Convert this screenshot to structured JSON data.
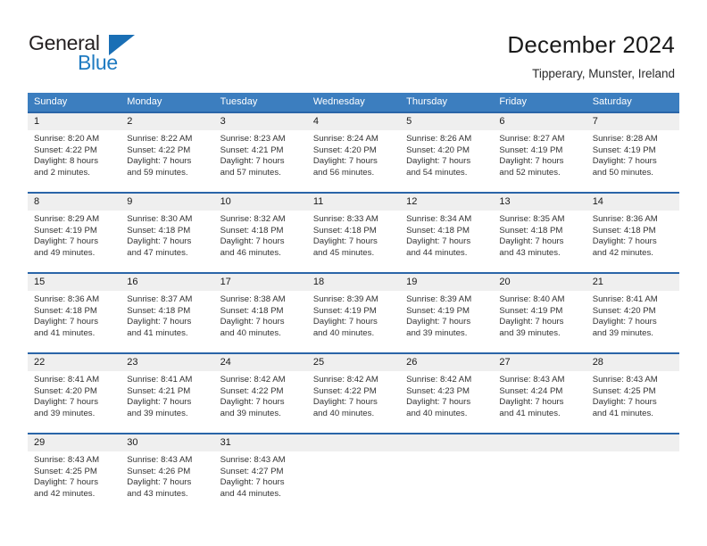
{
  "brand": {
    "name_part1": "General",
    "name_part2": "Blue",
    "flag_icon": "triangle-flag-icon",
    "accent_color": "#1a6fb5"
  },
  "header": {
    "title": "December 2024",
    "subtitle": "Tipperary, Munster, Ireland"
  },
  "colors": {
    "header_blue": "#3c7ebf",
    "separator_blue": "#2a65a8",
    "daynum_strip": "#efefef",
    "text": "#333333"
  },
  "calendar": {
    "day_headers": [
      "Sunday",
      "Monday",
      "Tuesday",
      "Wednesday",
      "Thursday",
      "Friday",
      "Saturday"
    ],
    "weeks": [
      [
        {
          "day": "1",
          "sunrise": "Sunrise: 8:20 AM",
          "sunset": "Sunset: 4:22 PM",
          "daylight1": "Daylight: 8 hours",
          "daylight2": "and 2 minutes."
        },
        {
          "day": "2",
          "sunrise": "Sunrise: 8:22 AM",
          "sunset": "Sunset: 4:22 PM",
          "daylight1": "Daylight: 7 hours",
          "daylight2": "and 59 minutes."
        },
        {
          "day": "3",
          "sunrise": "Sunrise: 8:23 AM",
          "sunset": "Sunset: 4:21 PM",
          "daylight1": "Daylight: 7 hours",
          "daylight2": "and 57 minutes."
        },
        {
          "day": "4",
          "sunrise": "Sunrise: 8:24 AM",
          "sunset": "Sunset: 4:20 PM",
          "daylight1": "Daylight: 7 hours",
          "daylight2": "and 56 minutes."
        },
        {
          "day": "5",
          "sunrise": "Sunrise: 8:26 AM",
          "sunset": "Sunset: 4:20 PM",
          "daylight1": "Daylight: 7 hours",
          "daylight2": "and 54 minutes."
        },
        {
          "day": "6",
          "sunrise": "Sunrise: 8:27 AM",
          "sunset": "Sunset: 4:19 PM",
          "daylight1": "Daylight: 7 hours",
          "daylight2": "and 52 minutes."
        },
        {
          "day": "7",
          "sunrise": "Sunrise: 8:28 AM",
          "sunset": "Sunset: 4:19 PM",
          "daylight1": "Daylight: 7 hours",
          "daylight2": "and 50 minutes."
        }
      ],
      [
        {
          "day": "8",
          "sunrise": "Sunrise: 8:29 AM",
          "sunset": "Sunset: 4:19 PM",
          "daylight1": "Daylight: 7 hours",
          "daylight2": "and 49 minutes."
        },
        {
          "day": "9",
          "sunrise": "Sunrise: 8:30 AM",
          "sunset": "Sunset: 4:18 PM",
          "daylight1": "Daylight: 7 hours",
          "daylight2": "and 47 minutes."
        },
        {
          "day": "10",
          "sunrise": "Sunrise: 8:32 AM",
          "sunset": "Sunset: 4:18 PM",
          "daylight1": "Daylight: 7 hours",
          "daylight2": "and 46 minutes."
        },
        {
          "day": "11",
          "sunrise": "Sunrise: 8:33 AM",
          "sunset": "Sunset: 4:18 PM",
          "daylight1": "Daylight: 7 hours",
          "daylight2": "and 45 minutes."
        },
        {
          "day": "12",
          "sunrise": "Sunrise: 8:34 AM",
          "sunset": "Sunset: 4:18 PM",
          "daylight1": "Daylight: 7 hours",
          "daylight2": "and 44 minutes."
        },
        {
          "day": "13",
          "sunrise": "Sunrise: 8:35 AM",
          "sunset": "Sunset: 4:18 PM",
          "daylight1": "Daylight: 7 hours",
          "daylight2": "and 43 minutes."
        },
        {
          "day": "14",
          "sunrise": "Sunrise: 8:36 AM",
          "sunset": "Sunset: 4:18 PM",
          "daylight1": "Daylight: 7 hours",
          "daylight2": "and 42 minutes."
        }
      ],
      [
        {
          "day": "15",
          "sunrise": "Sunrise: 8:36 AM",
          "sunset": "Sunset: 4:18 PM",
          "daylight1": "Daylight: 7 hours",
          "daylight2": "and 41 minutes."
        },
        {
          "day": "16",
          "sunrise": "Sunrise: 8:37 AM",
          "sunset": "Sunset: 4:18 PM",
          "daylight1": "Daylight: 7 hours",
          "daylight2": "and 41 minutes."
        },
        {
          "day": "17",
          "sunrise": "Sunrise: 8:38 AM",
          "sunset": "Sunset: 4:18 PM",
          "daylight1": "Daylight: 7 hours",
          "daylight2": "and 40 minutes."
        },
        {
          "day": "18",
          "sunrise": "Sunrise: 8:39 AM",
          "sunset": "Sunset: 4:19 PM",
          "daylight1": "Daylight: 7 hours",
          "daylight2": "and 40 minutes."
        },
        {
          "day": "19",
          "sunrise": "Sunrise: 8:39 AM",
          "sunset": "Sunset: 4:19 PM",
          "daylight1": "Daylight: 7 hours",
          "daylight2": "and 39 minutes."
        },
        {
          "day": "20",
          "sunrise": "Sunrise: 8:40 AM",
          "sunset": "Sunset: 4:19 PM",
          "daylight1": "Daylight: 7 hours",
          "daylight2": "and 39 minutes."
        },
        {
          "day": "21",
          "sunrise": "Sunrise: 8:41 AM",
          "sunset": "Sunset: 4:20 PM",
          "daylight1": "Daylight: 7 hours",
          "daylight2": "and 39 minutes."
        }
      ],
      [
        {
          "day": "22",
          "sunrise": "Sunrise: 8:41 AM",
          "sunset": "Sunset: 4:20 PM",
          "daylight1": "Daylight: 7 hours",
          "daylight2": "and 39 minutes."
        },
        {
          "day": "23",
          "sunrise": "Sunrise: 8:41 AM",
          "sunset": "Sunset: 4:21 PM",
          "daylight1": "Daylight: 7 hours",
          "daylight2": "and 39 minutes."
        },
        {
          "day": "24",
          "sunrise": "Sunrise: 8:42 AM",
          "sunset": "Sunset: 4:22 PM",
          "daylight1": "Daylight: 7 hours",
          "daylight2": "and 39 minutes."
        },
        {
          "day": "25",
          "sunrise": "Sunrise: 8:42 AM",
          "sunset": "Sunset: 4:22 PM",
          "daylight1": "Daylight: 7 hours",
          "daylight2": "and 40 minutes."
        },
        {
          "day": "26",
          "sunrise": "Sunrise: 8:42 AM",
          "sunset": "Sunset: 4:23 PM",
          "daylight1": "Daylight: 7 hours",
          "daylight2": "and 40 minutes."
        },
        {
          "day": "27",
          "sunrise": "Sunrise: 8:43 AM",
          "sunset": "Sunset: 4:24 PM",
          "daylight1": "Daylight: 7 hours",
          "daylight2": "and 41 minutes."
        },
        {
          "day": "28",
          "sunrise": "Sunrise: 8:43 AM",
          "sunset": "Sunset: 4:25 PM",
          "daylight1": "Daylight: 7 hours",
          "daylight2": "and 41 minutes."
        }
      ],
      [
        {
          "day": "29",
          "sunrise": "Sunrise: 8:43 AM",
          "sunset": "Sunset: 4:25 PM",
          "daylight1": "Daylight: 7 hours",
          "daylight2": "and 42 minutes."
        },
        {
          "day": "30",
          "sunrise": "Sunrise: 8:43 AM",
          "sunset": "Sunset: 4:26 PM",
          "daylight1": "Daylight: 7 hours",
          "daylight2": "and 43 minutes."
        },
        {
          "day": "31",
          "sunrise": "Sunrise: 8:43 AM",
          "sunset": "Sunset: 4:27 PM",
          "daylight1": "Daylight: 7 hours",
          "daylight2": "and 44 minutes."
        },
        {
          "day": "",
          "sunrise": "",
          "sunset": "",
          "daylight1": "",
          "daylight2": ""
        },
        {
          "day": "",
          "sunrise": "",
          "sunset": "",
          "daylight1": "",
          "daylight2": ""
        },
        {
          "day": "",
          "sunrise": "",
          "sunset": "",
          "daylight1": "",
          "daylight2": ""
        },
        {
          "day": "",
          "sunrise": "",
          "sunset": "",
          "daylight1": "",
          "daylight2": ""
        }
      ]
    ]
  }
}
